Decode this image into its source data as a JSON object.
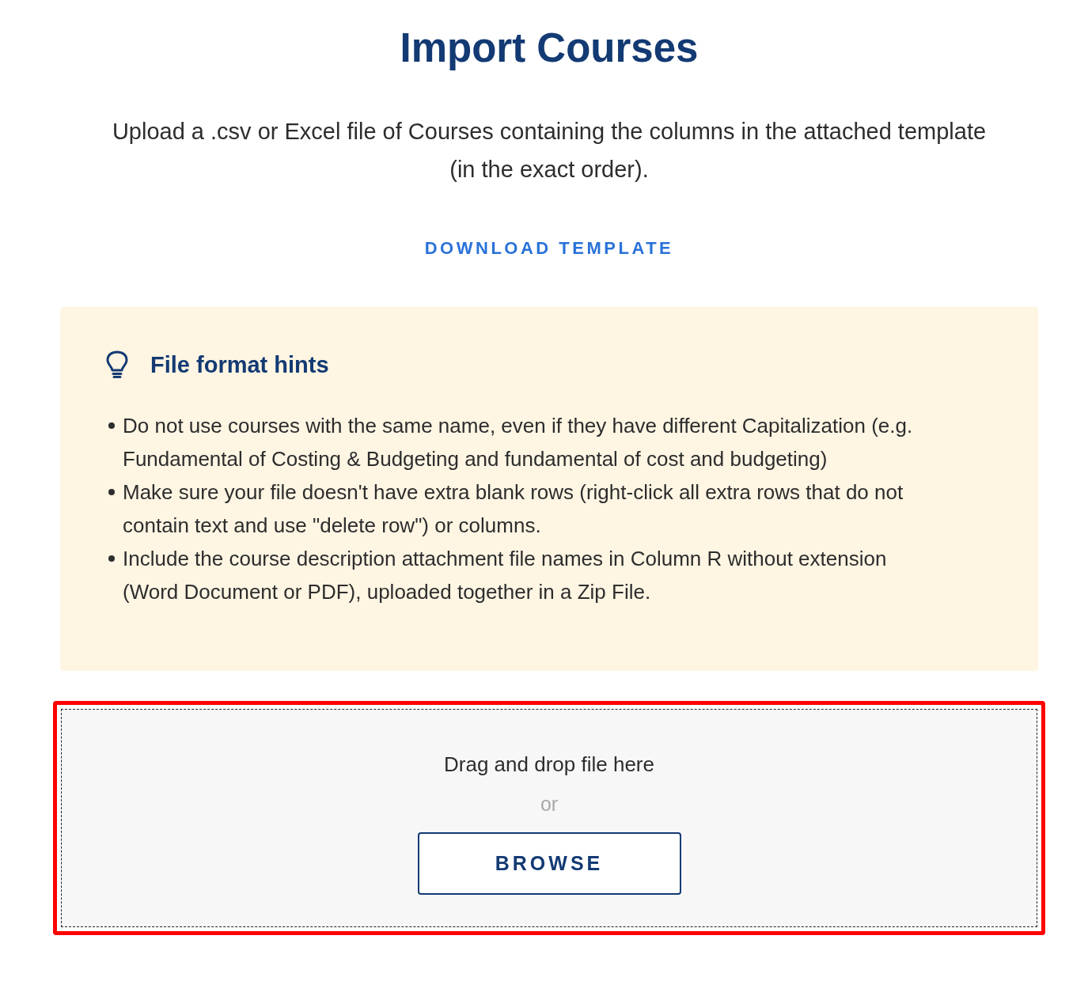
{
  "title": "Import Courses",
  "description": "Upload a .csv or Excel file of Courses containing the columns in the attached template (in the exact order).",
  "download_link": "DOWNLOAD TEMPLATE",
  "hints": {
    "title": "File format hints",
    "items": [
      "Do not use courses with the same name, even if they have different Capitalization (e.g. Fundamental of Costing & Budgeting and fundamental of cost and budgeting)",
      "Make sure your file doesn't have extra blank rows (right-click all extra rows that do not contain text and use \"delete row\") or columns.",
      "Include the course description attachment file names in Column R without extension (Word Document or PDF), uploaded together in a Zip File."
    ]
  },
  "drop_zone": {
    "highlighted": true,
    "prompt": "Drag and drop file here",
    "separator": "or",
    "browse_button": "BROWSE"
  }
}
